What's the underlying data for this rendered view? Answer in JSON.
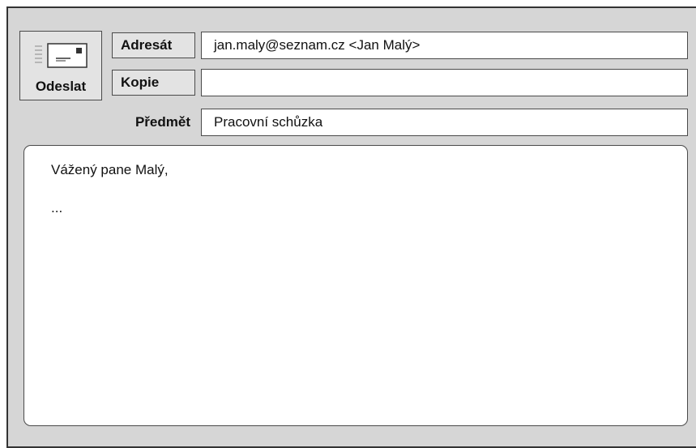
{
  "toolbar": {
    "send_label": "Odeslat",
    "send_icon": "envelope-icon"
  },
  "fields": {
    "to": {
      "label": "Adresát",
      "value": "jan.maly@seznam.cz <Jan Malý>"
    },
    "cc": {
      "label": "Kopie",
      "value": ""
    },
    "subject": {
      "label": "Předmět",
      "value": "Pracovní schůzka"
    }
  },
  "message": {
    "lines": [
      "Vážený pane Malý,",
      "..."
    ]
  }
}
